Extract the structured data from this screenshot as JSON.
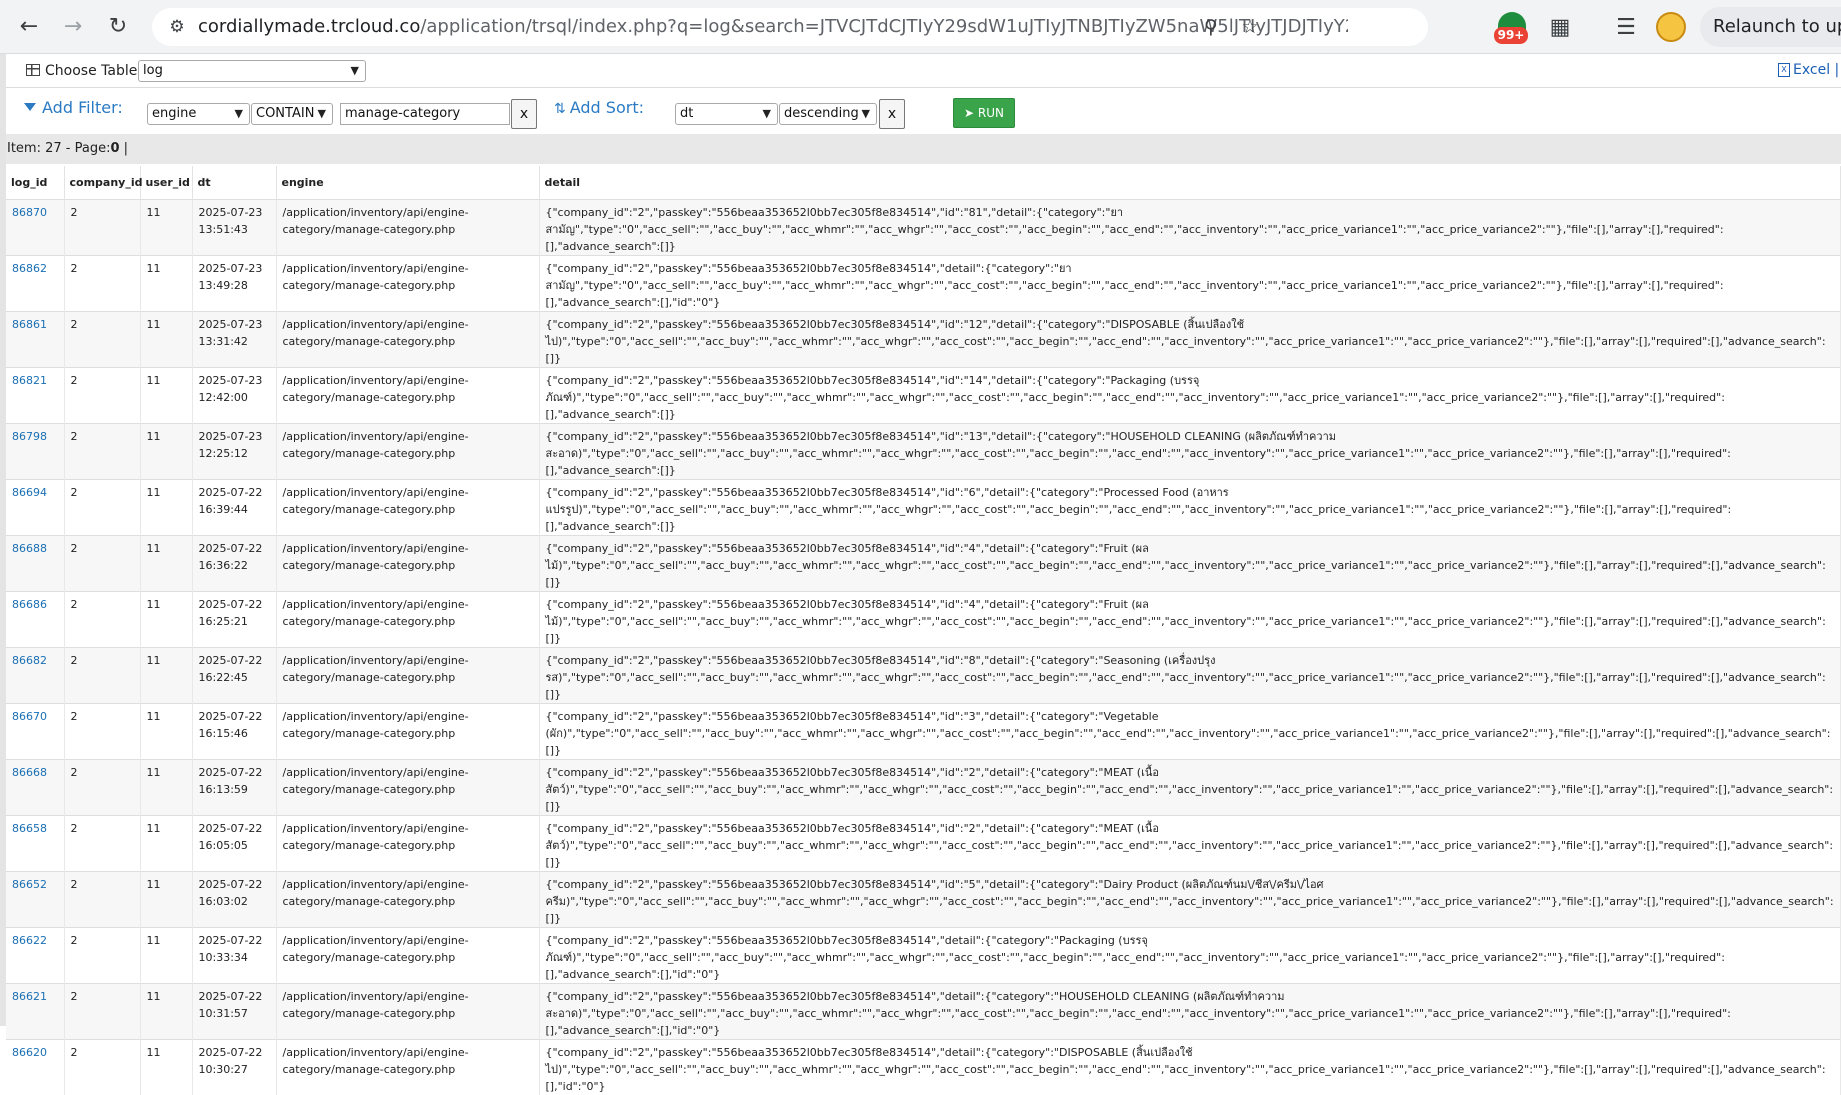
{
  "browser": {
    "url_host": "cordiallymade.trcloud.co",
    "url_rest": "/application/trsql/index.php?q=log&search=JTVCJTdCJTIyY29sdW1uJTIyJTNBJTIyZW5naW5lJTIyJTJDJTIyY29uZGl0aW9uJ...",
    "extension_badge": "99+",
    "relaunch_label": "Relaunch to up"
  },
  "toolbar": {
    "choose_table_label": "Choose Table:",
    "table_value": "log",
    "excel_label": "Excel |",
    "add_filter_label": "Add Filter:",
    "filter_column": "engine",
    "filter_condition": "CONTAIN",
    "filter_value": "manage-category",
    "filter_clear": "x",
    "add_sort_label": "Add Sort:",
    "sort_column": "dt",
    "sort_direction": "descending",
    "sort_clear": "x",
    "run_label": "RUN"
  },
  "status": {
    "items_text": "Item: 27 - Page:",
    "page_num": "0",
    "suffix": " |"
  },
  "table": {
    "headers": [
      "log_id",
      "company_id",
      "user_id",
      "dt",
      "engine",
      "detail"
    ],
    "rows": [
      {
        "log_id": "86870",
        "company_id": "2",
        "user_id": "11",
        "dt": "2025-07-23\n13:51:43",
        "engine": "/application/inventory/api/engine-\ncategory/manage-category.php",
        "detail": "{\"company_id\":\"2\",\"passkey\":\"556beaa353652l0bb7ec305f8e834514\",\"id\":\"81\",\"detail\":{\"category\":\"ยา\nสามัญ\",\"type\":\"0\",\"acc_sell\":\"\",\"acc_buy\":\"\",\"acc_whmr\":\"\",\"acc_whgr\":\"\",\"acc_cost\":\"\",\"acc_begin\":\"\",\"acc_end\":\"\",\"acc_inventory\":\"\",\"acc_price_variance1\":\"\",\"acc_price_variance2\":\"\"},\"file\":[],\"array\":[],\"required\":[],\"advance_search\":[]}"
      },
      {
        "log_id": "86862",
        "company_id": "2",
        "user_id": "11",
        "dt": "2025-07-23\n13:49:28",
        "engine": "/application/inventory/api/engine-\ncategory/manage-category.php",
        "detail": "{\"company_id\":\"2\",\"passkey\":\"556beaa353652l0bb7ec305f8e834514\",\"detail\":{\"category\":\"ยา\nสามัญ\",\"type\":\"0\",\"acc_sell\":\"\",\"acc_buy\":\"\",\"acc_whmr\":\"\",\"acc_whgr\":\"\",\"acc_cost\":\"\",\"acc_begin\":\"\",\"acc_end\":\"\",\"acc_inventory\":\"\",\"acc_price_variance1\":\"\",\"acc_price_variance2\":\"\"},\"file\":[],\"array\":[],\"required\":[],\"advance_search\":[],\"id\":\"0\"}"
      },
      {
        "log_id": "86861",
        "company_id": "2",
        "user_id": "11",
        "dt": "2025-07-23\n13:31:42",
        "engine": "/application/inventory/api/engine-\ncategory/manage-category.php",
        "detail": "{\"company_id\":\"2\",\"passkey\":\"556beaa353652l0bb7ec305f8e834514\",\"id\":\"12\",\"detail\":{\"category\":\"DISPOSABLE (สิ้นเปลืองใช้\nไป)\",\"type\":\"0\",\"acc_sell\":\"\",\"acc_buy\":\"\",\"acc_whmr\":\"\",\"acc_whgr\":\"\",\"acc_cost\":\"\",\"acc_begin\":\"\",\"acc_end\":\"\",\"acc_inventory\":\"\",\"acc_price_variance1\":\"\",\"acc_price_variance2\":\"\"},\"file\":[],\"array\":[],\"required\":[],\"advance_search\":[]}"
      },
      {
        "log_id": "86821",
        "company_id": "2",
        "user_id": "11",
        "dt": "2025-07-23\n12:42:00",
        "engine": "/application/inventory/api/engine-\ncategory/manage-category.php",
        "detail": "{\"company_id\":\"2\",\"passkey\":\"556beaa353652l0bb7ec305f8e834514\",\"id\":\"14\",\"detail\":{\"category\":\"Packaging (บรรจุ\nภัณฑ์)\",\"type\":\"0\",\"acc_sell\":\"\",\"acc_buy\":\"\",\"acc_whmr\":\"\",\"acc_whgr\":\"\",\"acc_cost\":\"\",\"acc_begin\":\"\",\"acc_end\":\"\",\"acc_inventory\":\"\",\"acc_price_variance1\":\"\",\"acc_price_variance2\":\"\"},\"file\":[],\"array\":[],\"required\":[],\"advance_search\":[]}"
      },
      {
        "log_id": "86798",
        "company_id": "2",
        "user_id": "11",
        "dt": "2025-07-23\n12:25:12",
        "engine": "/application/inventory/api/engine-\ncategory/manage-category.php",
        "detail": "{\"company_id\":\"2\",\"passkey\":\"556beaa353652l0bb7ec305f8e834514\",\"id\":\"13\",\"detail\":{\"category\":\"HOUSEHOLD CLEANING (ผลิตภัณฑ์ทำความ\nสะอาด)\",\"type\":\"0\",\"acc_sell\":\"\",\"acc_buy\":\"\",\"acc_whmr\":\"\",\"acc_whgr\":\"\",\"acc_cost\":\"\",\"acc_begin\":\"\",\"acc_end\":\"\",\"acc_inventory\":\"\",\"acc_price_variance1\":\"\",\"acc_price_variance2\":\"\"},\"file\":[],\"array\":[],\"required\":[],\"advance_search\":[]}"
      },
      {
        "log_id": "86694",
        "company_id": "2",
        "user_id": "11",
        "dt": "2025-07-22\n16:39:44",
        "engine": "/application/inventory/api/engine-\ncategory/manage-category.php",
        "detail": "{\"company_id\":\"2\",\"passkey\":\"556beaa353652l0bb7ec305f8e834514\",\"id\":\"6\",\"detail\":{\"category\":\"Processed Food (อาหาร\nแปรรูป)\",\"type\":\"0\",\"acc_sell\":\"\",\"acc_buy\":\"\",\"acc_whmr\":\"\",\"acc_whgr\":\"\",\"acc_cost\":\"\",\"acc_begin\":\"\",\"acc_end\":\"\",\"acc_inventory\":\"\",\"acc_price_variance1\":\"\",\"acc_price_variance2\":\"\"},\"file\":[],\"array\":[],\"required\":[],\"advance_search\":[]}"
      },
      {
        "log_id": "86688",
        "company_id": "2",
        "user_id": "11",
        "dt": "2025-07-22\n16:36:22",
        "engine": "/application/inventory/api/engine-\ncategory/manage-category.php",
        "detail": "{\"company_id\":\"2\",\"passkey\":\"556beaa353652l0bb7ec305f8e834514\",\"id\":\"4\",\"detail\":{\"category\":\"Fruit (ผล\nไม้)\",\"type\":\"0\",\"acc_sell\":\"\",\"acc_buy\":\"\",\"acc_whmr\":\"\",\"acc_whgr\":\"\",\"acc_cost\":\"\",\"acc_begin\":\"\",\"acc_end\":\"\",\"acc_inventory\":\"\",\"acc_price_variance1\":\"\",\"acc_price_variance2\":\"\"},\"file\":[],\"array\":[],\"required\":[],\"advance_search\":[]}"
      },
      {
        "log_id": "86686",
        "company_id": "2",
        "user_id": "11",
        "dt": "2025-07-22\n16:25:21",
        "engine": "/application/inventory/api/engine-\ncategory/manage-category.php",
        "detail": "{\"company_id\":\"2\",\"passkey\":\"556beaa353652l0bb7ec305f8e834514\",\"id\":\"4\",\"detail\":{\"category\":\"Fruit (ผล\nไม้)\",\"type\":\"0\",\"acc_sell\":\"\",\"acc_buy\":\"\",\"acc_whmr\":\"\",\"acc_whgr\":\"\",\"acc_cost\":\"\",\"acc_begin\":\"\",\"acc_end\":\"\",\"acc_inventory\":\"\",\"acc_price_variance1\":\"\",\"acc_price_variance2\":\"\"},\"file\":[],\"array\":[],\"required\":[],\"advance_search\":[]}"
      },
      {
        "log_id": "86682",
        "company_id": "2",
        "user_id": "11",
        "dt": "2025-07-22\n16:22:45",
        "engine": "/application/inventory/api/engine-\ncategory/manage-category.php",
        "detail": "{\"company_id\":\"2\",\"passkey\":\"556beaa353652l0bb7ec305f8e834514\",\"id\":\"8\",\"detail\":{\"category\":\"Seasoning (เครื่องปรุง\nรส)\",\"type\":\"0\",\"acc_sell\":\"\",\"acc_buy\":\"\",\"acc_whmr\":\"\",\"acc_whgr\":\"\",\"acc_cost\":\"\",\"acc_begin\":\"\",\"acc_end\":\"\",\"acc_inventory\":\"\",\"acc_price_variance1\":\"\",\"acc_price_variance2\":\"\"},\"file\":[],\"array\":[],\"required\":[],\"advance_search\":[]}"
      },
      {
        "log_id": "86670",
        "company_id": "2",
        "user_id": "11",
        "dt": "2025-07-22\n16:15:46",
        "engine": "/application/inventory/api/engine-\ncategory/manage-category.php",
        "detail": "{\"company_id\":\"2\",\"passkey\":\"556beaa353652l0bb7ec305f8e834514\",\"id\":\"3\",\"detail\":{\"category\":\"Vegetable\n(ผัก)\",\"type\":\"0\",\"acc_sell\":\"\",\"acc_buy\":\"\",\"acc_whmr\":\"\",\"acc_whgr\":\"\",\"acc_cost\":\"\",\"acc_begin\":\"\",\"acc_end\":\"\",\"acc_inventory\":\"\",\"acc_price_variance1\":\"\",\"acc_price_variance2\":\"\"},\"file\":[],\"array\":[],\"required\":[],\"advance_search\":[]}"
      },
      {
        "log_id": "86668",
        "company_id": "2",
        "user_id": "11",
        "dt": "2025-07-22\n16:13:59",
        "engine": "/application/inventory/api/engine-\ncategory/manage-category.php",
        "detail": "{\"company_id\":\"2\",\"passkey\":\"556beaa353652l0bb7ec305f8e834514\",\"id\":\"2\",\"detail\":{\"category\":\"MEAT (เนื้อ\nสัตว์)\",\"type\":\"0\",\"acc_sell\":\"\",\"acc_buy\":\"\",\"acc_whmr\":\"\",\"acc_whgr\":\"\",\"acc_cost\":\"\",\"acc_begin\":\"\",\"acc_end\":\"\",\"acc_inventory\":\"\",\"acc_price_variance1\":\"\",\"acc_price_variance2\":\"\"},\"file\":[],\"array\":[],\"required\":[],\"advance_search\":[]}"
      },
      {
        "log_id": "86658",
        "company_id": "2",
        "user_id": "11",
        "dt": "2025-07-22\n16:05:05",
        "engine": "/application/inventory/api/engine-\ncategory/manage-category.php",
        "detail": "{\"company_id\":\"2\",\"passkey\":\"556beaa353652l0bb7ec305f8e834514\",\"id\":\"2\",\"detail\":{\"category\":\"MEAT (เนื้อ\nสัตว์)\",\"type\":\"0\",\"acc_sell\":\"\",\"acc_buy\":\"\",\"acc_whmr\":\"\",\"acc_whgr\":\"\",\"acc_cost\":\"\",\"acc_begin\":\"\",\"acc_end\":\"\",\"acc_inventory\":\"\",\"acc_price_variance1\":\"\",\"acc_price_variance2\":\"\"},\"file\":[],\"array\":[],\"required\":[],\"advance_search\":[]}"
      },
      {
        "log_id": "86652",
        "company_id": "2",
        "user_id": "11",
        "dt": "2025-07-22\n16:03:02",
        "engine": "/application/inventory/api/engine-\ncategory/manage-category.php",
        "detail": "{\"company_id\":\"2\",\"passkey\":\"556beaa353652l0bb7ec305f8e834514\",\"id\":\"5\",\"detail\":{\"category\":\"Dairy Product (ผลิตภัณฑ์นม\\/ชีส\\/ครีม\\/ไอศ\nครีม)\",\"type\":\"0\",\"acc_sell\":\"\",\"acc_buy\":\"\",\"acc_whmr\":\"\",\"acc_whgr\":\"\",\"acc_cost\":\"\",\"acc_begin\":\"\",\"acc_end\":\"\",\"acc_inventory\":\"\",\"acc_price_variance1\":\"\",\"acc_price_variance2\":\"\"},\"file\":[],\"array\":[],\"required\":[],\"advance_search\":[]}"
      },
      {
        "log_id": "86622",
        "company_id": "2",
        "user_id": "11",
        "dt": "2025-07-22\n10:33:34",
        "engine": "/application/inventory/api/engine-\ncategory/manage-category.php",
        "detail": "{\"company_id\":\"2\",\"passkey\":\"556beaa353652l0bb7ec305f8e834514\",\"detail\":{\"category\":\"Packaging (บรรจุ\nภัณฑ์)\",\"type\":\"0\",\"acc_sell\":\"\",\"acc_buy\":\"\",\"acc_whmr\":\"\",\"acc_whgr\":\"\",\"acc_cost\":\"\",\"acc_begin\":\"\",\"acc_end\":\"\",\"acc_inventory\":\"\",\"acc_price_variance1\":\"\",\"acc_price_variance2\":\"\"},\"file\":[],\"array\":[],\"required\":[],\"advance_search\":[],\"id\":\"0\"}"
      },
      {
        "log_id": "86621",
        "company_id": "2",
        "user_id": "11",
        "dt": "2025-07-22\n10:31:57",
        "engine": "/application/inventory/api/engine-\ncategory/manage-category.php",
        "detail": "{\"company_id\":\"2\",\"passkey\":\"556beaa353652l0bb7ec305f8e834514\",\"detail\":{\"category\":\"HOUSEHOLD CLEANING (ผลิตภัณฑ์ทำความ\nสะอาด)\",\"type\":\"0\",\"acc_sell\":\"\",\"acc_buy\":\"\",\"acc_whmr\":\"\",\"acc_whgr\":\"\",\"acc_cost\":\"\",\"acc_begin\":\"\",\"acc_end\":\"\",\"acc_inventory\":\"\",\"acc_price_variance1\":\"\",\"acc_price_variance2\":\"\"},\"file\":[],\"array\":[],\"required\":[],\"advance_search\":[],\"id\":\"0\"}"
      },
      {
        "log_id": "86620",
        "company_id": "2",
        "user_id": "11",
        "dt": "2025-07-22\n10:30:27",
        "engine": "/application/inventory/api/engine-\ncategory/manage-category.php",
        "detail": "{\"company_id\":\"2\",\"passkey\":\"556beaa353652l0bb7ec305f8e834514\",\"detail\":{\"category\":\"DISPOSABLE (สิ้นเปลืองใช้\nไป)\",\"type\":\"0\",\"acc_sell\":\"\",\"acc_buy\":\"\",\"acc_whmr\":\"\",\"acc_whgr\":\"\",\"acc_cost\":\"\",\"acc_begin\":\"\",\"acc_end\":\"\",\"acc_inventory\":\"\",\"acc_price_variance1\":\"\",\"acc_price_variance2\":\"\"},\"file\":[],\"array\":[],\"required\":[],\"advance_search\":[],\"id\":\"0\"}"
      }
    ]
  }
}
